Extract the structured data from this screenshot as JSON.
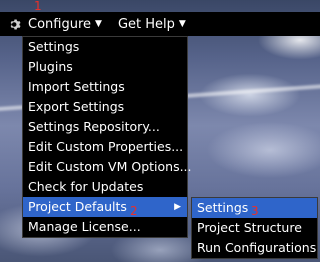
{
  "annotations": {
    "first": "1",
    "second": "2",
    "third": "3"
  },
  "topbar": {
    "configure_label": "Configure",
    "help_label": "Get Help"
  },
  "menu": {
    "items": [
      {
        "label": "Settings"
      },
      {
        "label": "Plugins"
      },
      {
        "label": "Import Settings"
      },
      {
        "label": "Export Settings"
      },
      {
        "label": "Settings Repository..."
      },
      {
        "label": "Edit Custom Properties..."
      },
      {
        "label": "Edit Custom VM Options..."
      },
      {
        "label": "Check for Updates"
      },
      {
        "label": "Project Defaults"
      },
      {
        "label": "Manage License..."
      }
    ]
  },
  "submenu": {
    "items": [
      {
        "label": "Settings"
      },
      {
        "label": "Project Structure"
      },
      {
        "label": "Run Configurations"
      }
    ]
  }
}
